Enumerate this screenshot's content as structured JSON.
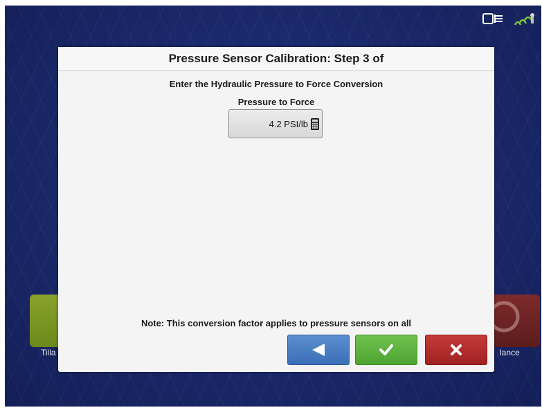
{
  "background_apps": {
    "left_tile_label": "Tilla",
    "right_tile_label": "lance"
  },
  "dialog": {
    "title": "Pressure Sensor Calibration: Step 3 of",
    "instruction": "Enter the Hydraulic Pressure to Force Conversion",
    "field_label": "Pressure to Force",
    "field_value": "4.2 PSI/lb",
    "note": "Note: This conversion factor applies to pressure sensors on all"
  },
  "buttons": {
    "back_icon": "left-triangle-icon",
    "accept_icon": "checkmark-icon",
    "cancel_icon": "x-icon"
  },
  "colors": {
    "back": "#4a7fc4",
    "accept": "#5db33c",
    "cancel": "#b22c2c"
  }
}
